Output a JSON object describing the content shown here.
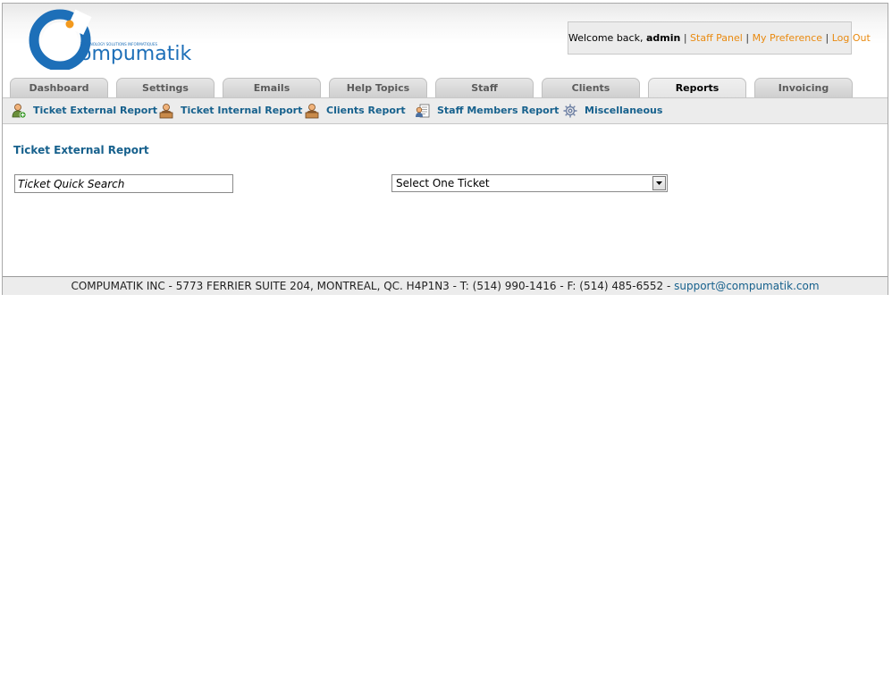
{
  "brand": {
    "name": "ompumatik",
    "tagline": "TECHNOLOGY SOLUTIONS INFORMATIQUES",
    "colors": {
      "blue": "#1d6fb8",
      "orange": "#f39a1e"
    }
  },
  "welcome": {
    "greeting": "Welcome back,",
    "user": "admin",
    "separator": "|",
    "links": {
      "staff_panel": "Staff Panel",
      "my_preference": "My Preference",
      "log_out": "Log Out"
    }
  },
  "tabs": [
    {
      "label": "Dashboard"
    },
    {
      "label": "Settings"
    },
    {
      "label": "Emails"
    },
    {
      "label": "Help Topics"
    },
    {
      "label": "Staff"
    },
    {
      "label": "Clients"
    },
    {
      "label": "Reports",
      "active": true
    },
    {
      "label": "Invoicing"
    }
  ],
  "subnav": [
    {
      "label": "Ticket External Report",
      "icon": "user-add-icon"
    },
    {
      "label": "Ticket Internal Report",
      "icon": "user-desk-icon"
    },
    {
      "label": "Clients Report",
      "icon": "user-desk-icon"
    },
    {
      "label": "Staff Members Report",
      "icon": "staff-document-icon"
    },
    {
      "label": "Miscellaneous",
      "icon": "gear-icon"
    }
  ],
  "main": {
    "title": "Ticket External Report",
    "search": {
      "placeholder": "Ticket Quick Search",
      "value": ""
    },
    "ticket_select": {
      "selected": "Select One Ticket"
    }
  },
  "footer": {
    "text": "COMPUMATIK INC - 5773 FERRIER SUITE 204, MONTREAL, QC. H4P1N3 - T: (514) 990-1416 - F: (514) 485-6552 -",
    "email": "support@compumatik.com"
  }
}
